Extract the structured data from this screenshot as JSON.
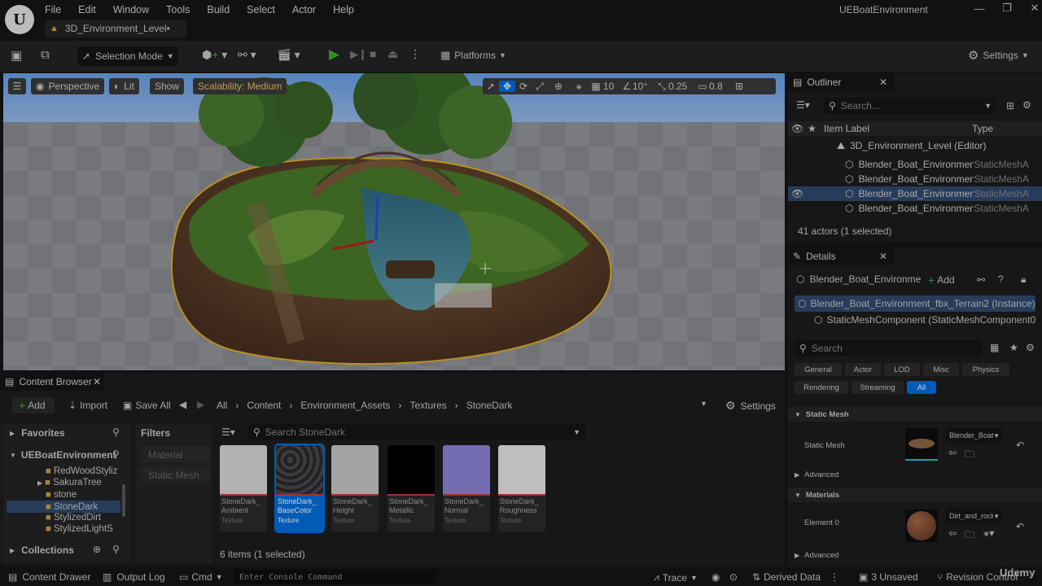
{
  "menu": {
    "items": [
      "File",
      "Edit",
      "Window",
      "Tools",
      "Build",
      "Select",
      "Actor",
      "Help"
    ]
  },
  "level_tab": "3D_Environment_Level•",
  "app_title": "UEBoatEnvironment",
  "toolbar": {
    "selection_mode": "Selection Mode",
    "platforms": "Platforms",
    "settings": "Settings"
  },
  "viewport": {
    "perspective": "Perspective",
    "lit": "Lit",
    "show": "Show",
    "scalability": "Scalability: Medium",
    "grid_snap": "10",
    "rotation_snap": "10°",
    "scale_snap": "0.25",
    "camera_speed": "0.8"
  },
  "outliner": {
    "title": "Outliner",
    "search_placeholder": "Search...",
    "col_label": "Item Label",
    "col_type": "Type",
    "root": "3D_Environment_Level (Editor)",
    "rows": [
      {
        "label": "Blender_Boat_Environmen",
        "type": "StaticMeshA"
      },
      {
        "label": "Blender_Boat_Environmen",
        "type": "StaticMeshA"
      },
      {
        "label": "Blender_Boat_Environmen",
        "type": "StaticMeshA"
      },
      {
        "label": "Blender_Boat_Environmen",
        "type": "StaticMeshA"
      }
    ],
    "count": "41 actors (1 selected)"
  },
  "details": {
    "title": "Details",
    "object_name": "Blender_Boat_Environme",
    "add": "Add",
    "instance": "Blender_Boat_Environment_fbx_Terrain2 (Instance)",
    "component": "StaticMeshComponent (StaticMeshComponent0)",
    "search_placeholder": "Search",
    "filters": [
      "General",
      "Actor",
      "LOD",
      "Misc",
      "Physics",
      "Rendering",
      "Streaming",
      "All"
    ],
    "section_static_mesh": "Static Mesh",
    "static_mesh_label": "Static Mesh",
    "static_mesh_value": "Blender_Boat",
    "advanced": "Advanced",
    "section_materials": "Materials",
    "element0_label": "Element 0",
    "element0_value": "Dirt_and_rock",
    "advanced2": "Advanced"
  },
  "content_browser": {
    "title": "Content Browser",
    "add": "Add",
    "import": "Import",
    "save_all": "Save All",
    "breadcrumb": [
      "All",
      "Content",
      "Environment_Assets",
      "Textures",
      "StoneDark"
    ],
    "settings": "Settings",
    "favorites": "Favorites",
    "project": "UEBoatEnvironment",
    "folders": [
      "RedWoodStyliz",
      "SakuraTree",
      "stone",
      "StoneDark",
      "StylizedDirt",
      "StylizedLightS"
    ],
    "collections": "Collections",
    "filters_title": "Filters",
    "filter_items": [
      "Material",
      "Static Mesh"
    ],
    "search_placeholder": "Search StoneDark",
    "assets": [
      {
        "name": "StoneDark_\nAmbient",
        "type": "Texture",
        "color": "#d8d8d8"
      },
      {
        "name": "StoneDark_\nBaseColor",
        "type": "Texture",
        "color": "#3a3a3c"
      },
      {
        "name": "StoneDark_\nHeight",
        "type": "Texture",
        "color": "#c9c9c9"
      },
      {
        "name": "StoneDark_\nMetallic",
        "type": "Texture",
        "color": "#000000"
      },
      {
        "name": "StoneDark_\nNormal",
        "type": "Texture",
        "color": "#8f86d8"
      },
      {
        "name": "StoneDark_\nRoughness",
        "type": "Texture",
        "color": "#e8e8e8"
      }
    ],
    "count": "6 items (1 selected)"
  },
  "statusbar": {
    "content_drawer": "Content Drawer",
    "output_log": "Output Log",
    "cmd": "Cmd",
    "console_placeholder": "Enter Console Command",
    "trace": "Trace",
    "derived_data": "Derived Data",
    "unsaved": "3 Unsaved",
    "revision_control": "Revision Control",
    "watermark": "Udemy"
  },
  "colors": {
    "accent": "#0070e0",
    "selected_row": "#2f4a6e",
    "play_green": "#3bb03b",
    "scalability_text": "#e8c060"
  }
}
